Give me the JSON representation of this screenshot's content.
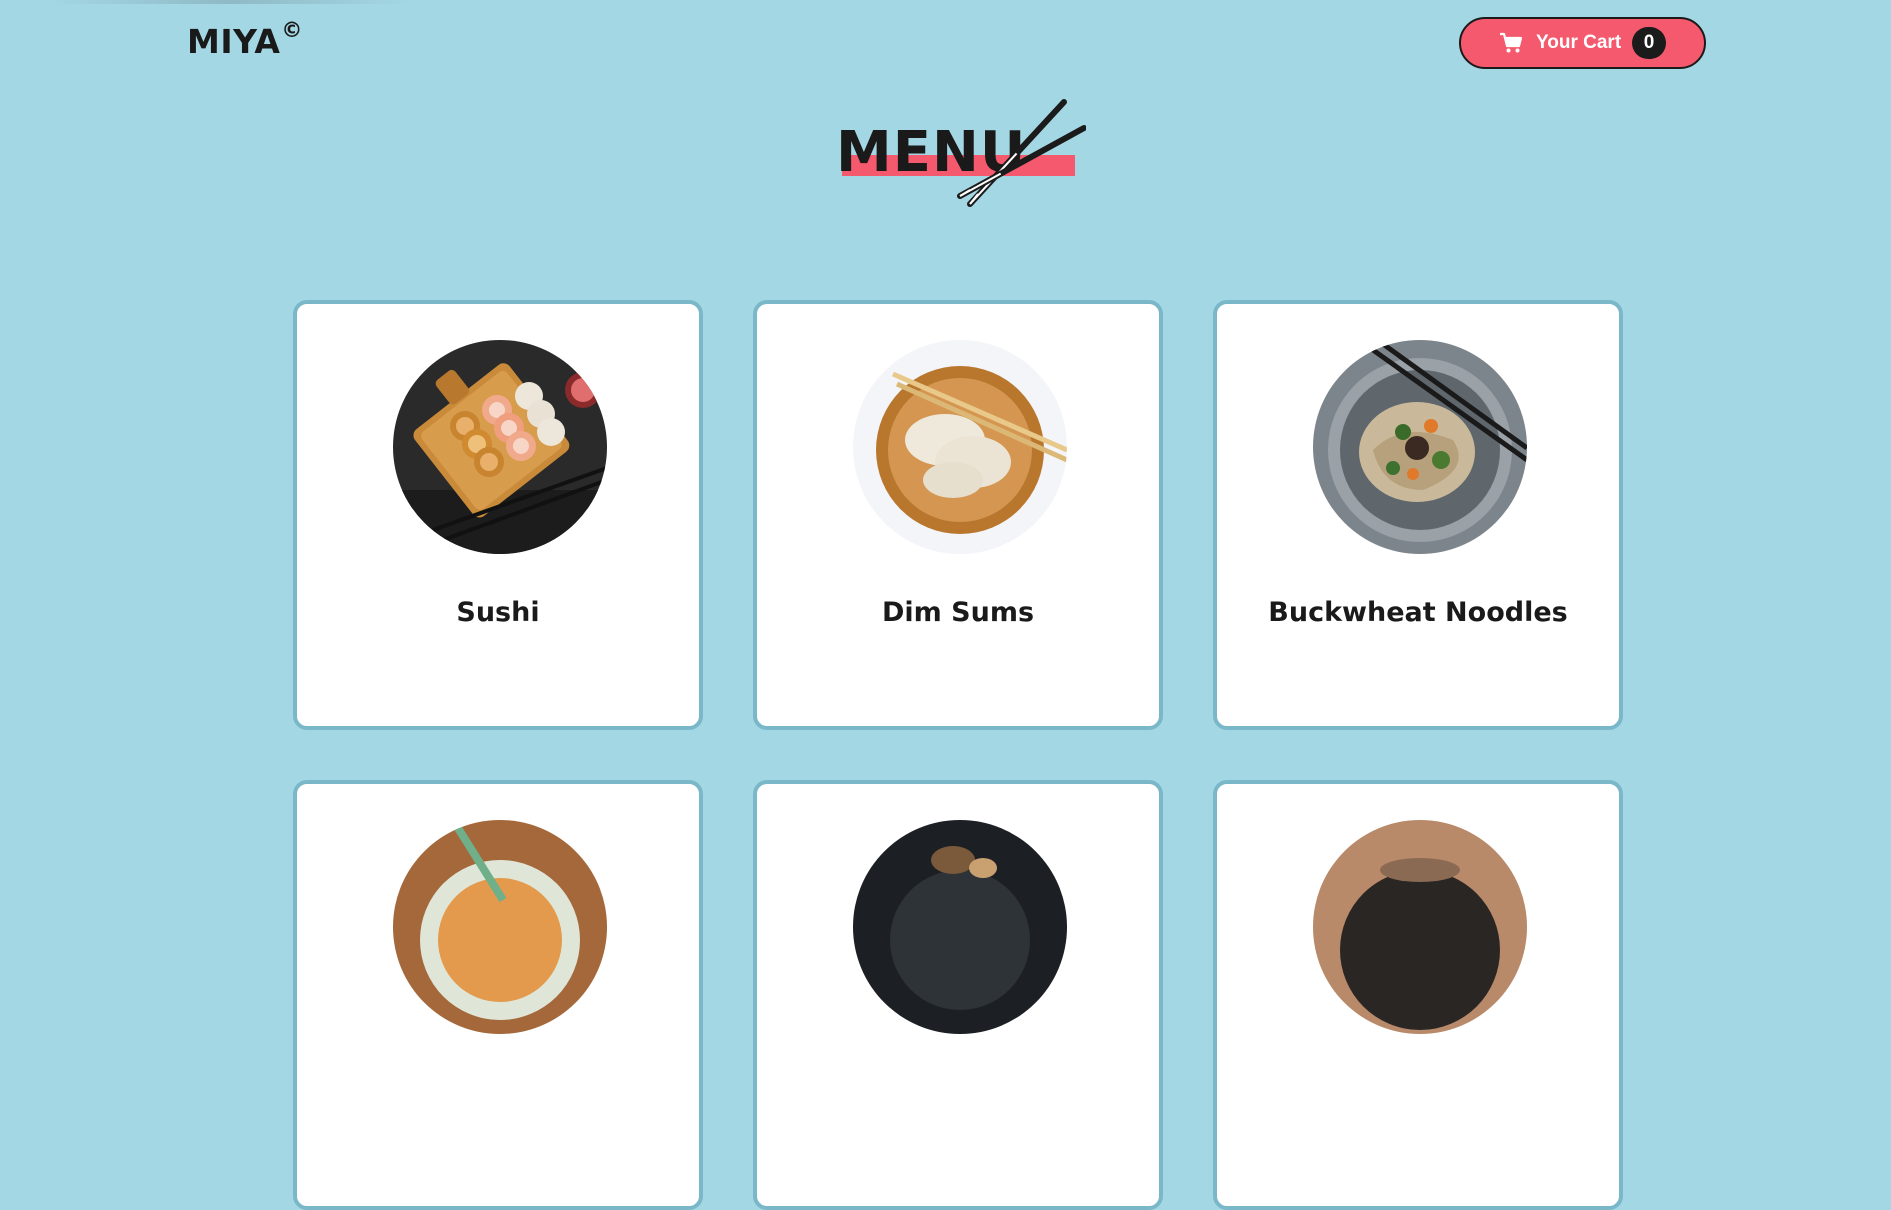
{
  "brand": {
    "name": "MIYA",
    "mark": "©"
  },
  "cart": {
    "label": "Your Cart",
    "count": "0",
    "icon": "cart-icon"
  },
  "heading": {
    "title": "MENU",
    "decoration": "chopsticks-icon"
  },
  "menu_items": [
    {
      "name": "Sushi",
      "image": "sushi-image"
    },
    {
      "name": "Dim Sums",
      "image": "dim-sums-image"
    },
    {
      "name": "Buckwheat Noodles",
      "image": "buckwheat-noodles-image"
    },
    {
      "name": "",
      "image": "noodle-bowl-image"
    },
    {
      "name": "",
      "image": "dark-bowl-image"
    },
    {
      "name": "",
      "image": "dish-image"
    }
  ],
  "colors": {
    "background": "#a3d7e4",
    "accent": "#f5596d",
    "card_border": "#7ab8c9",
    "dark": "#1b1b1b"
  }
}
